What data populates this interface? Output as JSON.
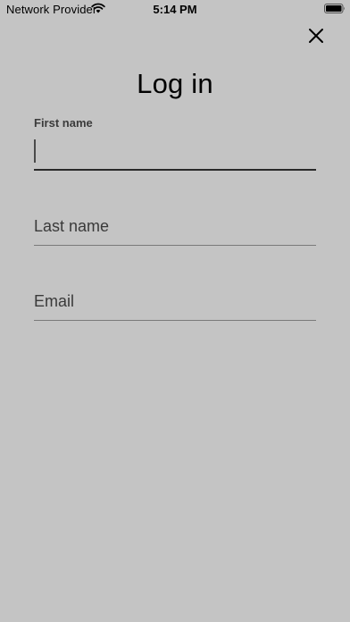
{
  "status_bar": {
    "carrier": "Network Provider",
    "time": "5:14 PM"
  },
  "page": {
    "title": "Log in"
  },
  "form": {
    "first_name": {
      "label": "First name",
      "value": ""
    },
    "last_name": {
      "placeholder": "Last name",
      "value": ""
    },
    "email": {
      "placeholder": "Email",
      "value": ""
    }
  },
  "icons": {
    "wifi": "wifi-icon",
    "battery": "battery-icon",
    "close": "close-icon"
  },
  "colors": {
    "background": "#c4c4c4",
    "focused_underline": "#2a2a2a",
    "underline": "#7a7a7a"
  }
}
